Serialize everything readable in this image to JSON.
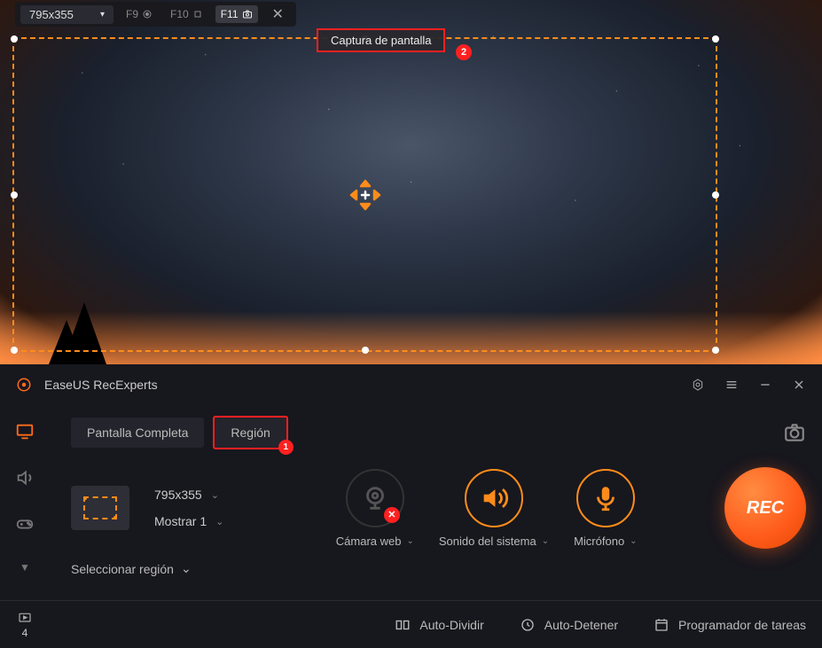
{
  "toolbar": {
    "resolution": "795x355",
    "hotkeys": {
      "f9": "F9",
      "f10": "F10",
      "f11": "F11"
    },
    "tooltip": "Captura de pantalla",
    "tooltip_badge": "2"
  },
  "app": {
    "brand": "EaseUS RecExperts"
  },
  "tabs": {
    "fullscreen": "Pantalla Completa",
    "region": "Región",
    "region_badge": "1"
  },
  "region_info": {
    "size": "795x355",
    "display_label": "Mostrar 1",
    "select_label": "Seleccionar región"
  },
  "devices": {
    "camera": "Cámara web",
    "system_sound": "Sonido del sistema",
    "microphone": "Micrófono"
  },
  "rec_label": "REC",
  "bottom": {
    "recordings_count": "4",
    "auto_split": "Auto-Dividir",
    "auto_stop": "Auto-Detener",
    "scheduler": "Programador de tareas"
  }
}
